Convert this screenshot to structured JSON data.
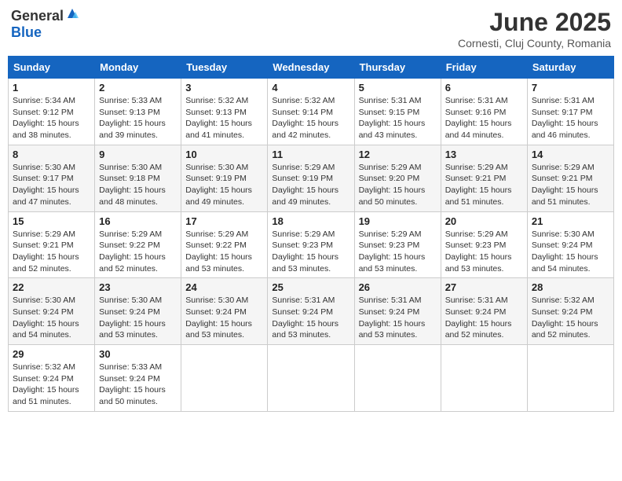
{
  "logo": {
    "general": "General",
    "blue": "Blue"
  },
  "title": "June 2025",
  "location": "Cornesti, Cluj County, Romania",
  "headers": [
    "Sunday",
    "Monday",
    "Tuesday",
    "Wednesday",
    "Thursday",
    "Friday",
    "Saturday"
  ],
  "weeks": [
    [
      {
        "day": "1",
        "sunrise": "5:34 AM",
        "sunset": "9:12 PM",
        "daylight": "15 hours and 38 minutes."
      },
      {
        "day": "2",
        "sunrise": "5:33 AM",
        "sunset": "9:13 PM",
        "daylight": "15 hours and 39 minutes."
      },
      {
        "day": "3",
        "sunrise": "5:32 AM",
        "sunset": "9:13 PM",
        "daylight": "15 hours and 41 minutes."
      },
      {
        "day": "4",
        "sunrise": "5:32 AM",
        "sunset": "9:14 PM",
        "daylight": "15 hours and 42 minutes."
      },
      {
        "day": "5",
        "sunrise": "5:31 AM",
        "sunset": "9:15 PM",
        "daylight": "15 hours and 43 minutes."
      },
      {
        "day": "6",
        "sunrise": "5:31 AM",
        "sunset": "9:16 PM",
        "daylight": "15 hours and 44 minutes."
      },
      {
        "day": "7",
        "sunrise": "5:31 AM",
        "sunset": "9:17 PM",
        "daylight": "15 hours and 46 minutes."
      }
    ],
    [
      {
        "day": "8",
        "sunrise": "5:30 AM",
        "sunset": "9:17 PM",
        "daylight": "15 hours and 47 minutes."
      },
      {
        "day": "9",
        "sunrise": "5:30 AM",
        "sunset": "9:18 PM",
        "daylight": "15 hours and 48 minutes."
      },
      {
        "day": "10",
        "sunrise": "5:30 AM",
        "sunset": "9:19 PM",
        "daylight": "15 hours and 49 minutes."
      },
      {
        "day": "11",
        "sunrise": "5:29 AM",
        "sunset": "9:19 PM",
        "daylight": "15 hours and 49 minutes."
      },
      {
        "day": "12",
        "sunrise": "5:29 AM",
        "sunset": "9:20 PM",
        "daylight": "15 hours and 50 minutes."
      },
      {
        "day": "13",
        "sunrise": "5:29 AM",
        "sunset": "9:21 PM",
        "daylight": "15 hours and 51 minutes."
      },
      {
        "day": "14",
        "sunrise": "5:29 AM",
        "sunset": "9:21 PM",
        "daylight": "15 hours and 51 minutes."
      }
    ],
    [
      {
        "day": "15",
        "sunrise": "5:29 AM",
        "sunset": "9:21 PM",
        "daylight": "15 hours and 52 minutes."
      },
      {
        "day": "16",
        "sunrise": "5:29 AM",
        "sunset": "9:22 PM",
        "daylight": "15 hours and 52 minutes."
      },
      {
        "day": "17",
        "sunrise": "5:29 AM",
        "sunset": "9:22 PM",
        "daylight": "15 hours and 53 minutes."
      },
      {
        "day": "18",
        "sunrise": "5:29 AM",
        "sunset": "9:23 PM",
        "daylight": "15 hours and 53 minutes."
      },
      {
        "day": "19",
        "sunrise": "5:29 AM",
        "sunset": "9:23 PM",
        "daylight": "15 hours and 53 minutes."
      },
      {
        "day": "20",
        "sunrise": "5:29 AM",
        "sunset": "9:23 PM",
        "daylight": "15 hours and 53 minutes."
      },
      {
        "day": "21",
        "sunrise": "5:30 AM",
        "sunset": "9:24 PM",
        "daylight": "15 hours and 54 minutes."
      }
    ],
    [
      {
        "day": "22",
        "sunrise": "5:30 AM",
        "sunset": "9:24 PM",
        "daylight": "15 hours and 54 minutes."
      },
      {
        "day": "23",
        "sunrise": "5:30 AM",
        "sunset": "9:24 PM",
        "daylight": "15 hours and 53 minutes."
      },
      {
        "day": "24",
        "sunrise": "5:30 AM",
        "sunset": "9:24 PM",
        "daylight": "15 hours and 53 minutes."
      },
      {
        "day": "25",
        "sunrise": "5:31 AM",
        "sunset": "9:24 PM",
        "daylight": "15 hours and 53 minutes."
      },
      {
        "day": "26",
        "sunrise": "5:31 AM",
        "sunset": "9:24 PM",
        "daylight": "15 hours and 53 minutes."
      },
      {
        "day": "27",
        "sunrise": "5:31 AM",
        "sunset": "9:24 PM",
        "daylight": "15 hours and 52 minutes."
      },
      {
        "day": "28",
        "sunrise": "5:32 AM",
        "sunset": "9:24 PM",
        "daylight": "15 hours and 52 minutes."
      }
    ],
    [
      {
        "day": "29",
        "sunrise": "5:32 AM",
        "sunset": "9:24 PM",
        "daylight": "15 hours and 51 minutes."
      },
      {
        "day": "30",
        "sunrise": "5:33 AM",
        "sunset": "9:24 PM",
        "daylight": "15 hours and 50 minutes."
      },
      null,
      null,
      null,
      null,
      null
    ]
  ]
}
